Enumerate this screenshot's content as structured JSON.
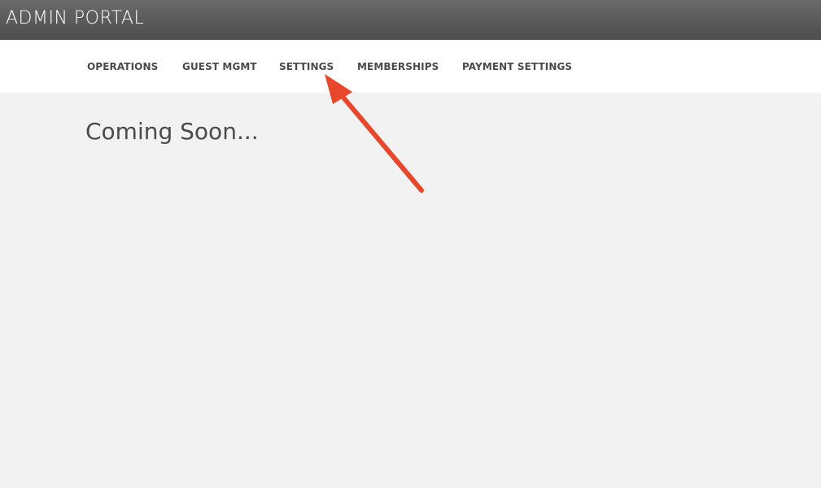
{
  "header": {
    "brand": "ADMIN PORTAL"
  },
  "nav": {
    "items": [
      {
        "label": "OPERATIONS"
      },
      {
        "label": "GUEST MGMT"
      },
      {
        "label": "SETTINGS"
      },
      {
        "label": "MEMBERSHIPS"
      },
      {
        "label": "PAYMENT SETTINGS"
      }
    ]
  },
  "main": {
    "title": "Coming Soon..."
  },
  "annotation": {
    "arrow_color": "#e8472b",
    "arrow_points_to": "SETTINGS"
  }
}
